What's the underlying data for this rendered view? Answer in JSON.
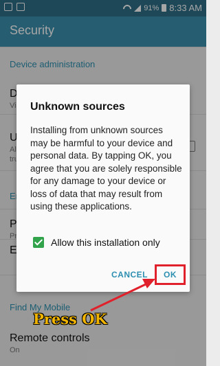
{
  "status_bar": {
    "battery": "91%",
    "time": "8:33 AM"
  },
  "app_bar": {
    "title": "Security"
  },
  "settings": {
    "device_admin_header": "Device administration",
    "row_d": "D",
    "row_d_sub": "Vi",
    "row_u": "U",
    "row_u_sub1": "Al",
    "row_u_sub2": "tru",
    "section_en": "En",
    "row_p": "P",
    "row_p_sub": "Pr",
    "row_en2": "En",
    "find_my_mobile_header": "Find My Mobile",
    "remote_controls_label": "Remote controls",
    "remote_controls_sub": "On"
  },
  "dialog": {
    "title": "Unknown sources",
    "message": "Installing from unknown sources may be harmful to your device and personal data. By tapping OK, you agree that you are solely responsible for any damage to your device or loss of data that may result from using these applications.",
    "checkbox_label": "Allow this installation only",
    "cancel_label": "CANCEL",
    "ok_label": "OK"
  },
  "annotation": {
    "text": "Press OK"
  },
  "colors": {
    "accent": "#2c8fb0",
    "highlight": "#e0202a",
    "checkbox": "#31a34a",
    "annotation": "#f0b400"
  }
}
